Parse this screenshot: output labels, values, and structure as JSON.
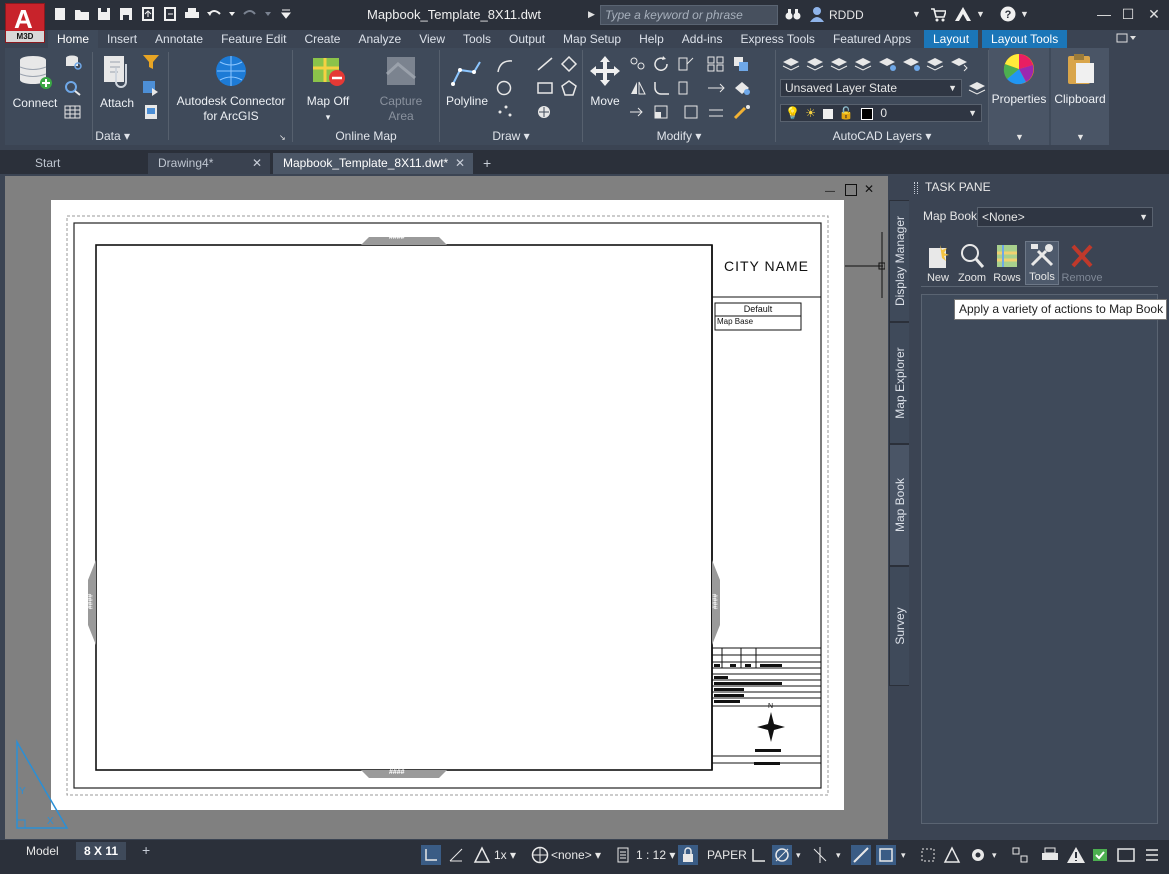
{
  "app": {
    "logo_letter": "A",
    "logo_badge": "M3D",
    "document_title": "Mapbook_Template_8X11.dwt",
    "search_placeholder": "Type a keyword or phrase",
    "user": "RDDD"
  },
  "ribbon_tabs": [
    {
      "label": "Home",
      "active": true
    },
    {
      "label": "Insert"
    },
    {
      "label": "Annotate"
    },
    {
      "label": "Feature Edit"
    },
    {
      "label": "Create"
    },
    {
      "label": "Analyze"
    },
    {
      "label": "View"
    },
    {
      "label": "Tools"
    },
    {
      "label": "Output"
    },
    {
      "label": "Map Setup"
    },
    {
      "label": "Help"
    },
    {
      "label": "Add-ins"
    },
    {
      "label": "Express Tools"
    },
    {
      "label": "Featured Apps"
    },
    {
      "label": "Layout",
      "contextual": true
    },
    {
      "label": "Layout Tools",
      "contextual": true
    }
  ],
  "ribbon": {
    "connect": "Connect",
    "attach": "Attach",
    "data_panel": "Data",
    "connector_line1": "Autodesk Connector",
    "connector_line2": "for ArcGIS",
    "map_off": "Map Off",
    "capture_line1": "Capture",
    "capture_line2": "Area",
    "online_map_panel": "Online Map",
    "polyline": "Polyline",
    "draw_panel": "Draw",
    "move": "Move",
    "modify_panel": "Modify",
    "layer_state": "Unsaved Layer State",
    "layer_current": "0",
    "layers_panel": "AutoCAD Layers",
    "properties": "Properties",
    "clipboard": "Clipboard"
  },
  "file_tabs": [
    {
      "label": "Start"
    },
    {
      "label": "Drawing4*"
    },
    {
      "label": "Mapbook_Template_8X11.dwt*",
      "active": true
    }
  ],
  "drawing": {
    "city_name": "CITY NAME",
    "legend_title": "Default",
    "legend_item": "Map Base",
    "tab_text": "####",
    "north": "N"
  },
  "task_pane": {
    "title": "TASK PANE",
    "map_book_label": "Map Book",
    "map_book_value": "<None>",
    "tools": [
      {
        "label": "New",
        "icon": "new-icon",
        "enabled": true
      },
      {
        "label": "Zoom",
        "icon": "zoom-icon",
        "enabled": true
      },
      {
        "label": "Rows",
        "icon": "rows-icon",
        "enabled": true
      },
      {
        "label": "Tools",
        "icon": "tools-icon",
        "enabled": true
      },
      {
        "label": "Remove",
        "icon": "remove-icon",
        "enabled": false
      }
    ],
    "side_tabs": [
      "Display Manager",
      "Map Explorer",
      "Map Book",
      "Survey"
    ],
    "tooltip": "Apply a variety of actions to Map Book"
  },
  "status": {
    "model_tab": "Model",
    "layout_tab": "8 X 11",
    "annotation_scale": "1x",
    "coordinate_system": "<none>",
    "scale": "1 : 12",
    "paper": "PAPER"
  },
  "colors": {
    "accent": "#1b76b8",
    "ribbon_bg": "#3f4a5a",
    "title_bg": "#2b303a",
    "logo_red": "#c8232b",
    "remove_red": "#c0392b"
  }
}
